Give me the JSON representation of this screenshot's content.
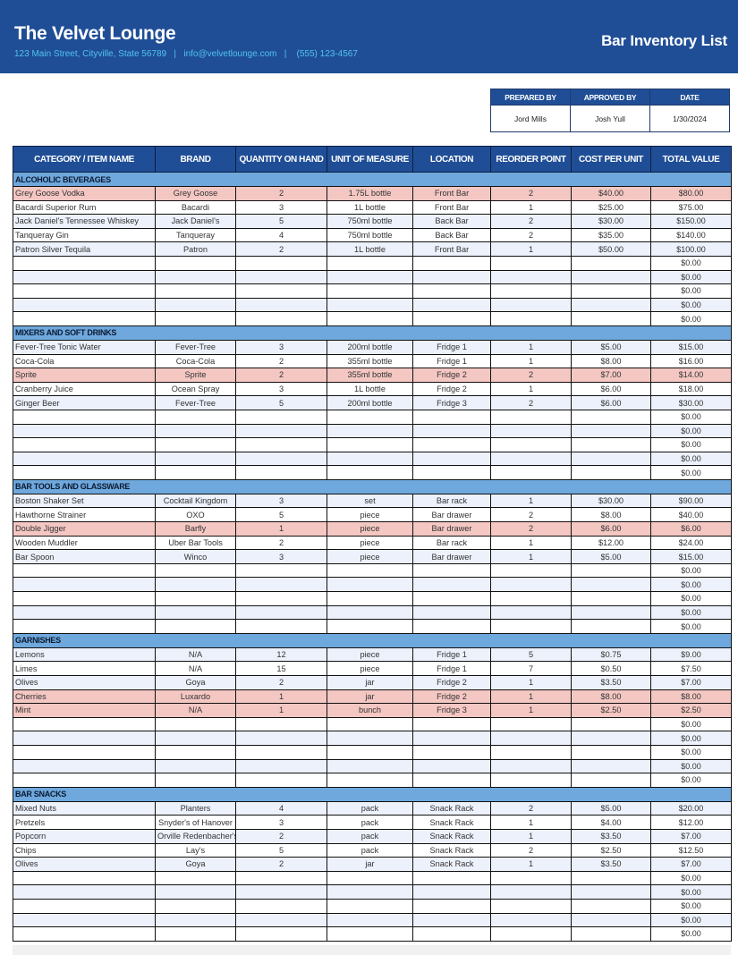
{
  "header": {
    "company_name": "The Velvet Lounge",
    "contact_line": "123 Main Street, Cityville, State 56789   |   info@velvetlounge.com   |    (555) 123-4567",
    "document_title": "Bar Inventory List"
  },
  "signoff": {
    "headers": [
      "PREPARED BY",
      "APPROVED BY",
      "DATE"
    ],
    "values": [
      "Jord Mills",
      "Josh Yull",
      "1/30/2024"
    ]
  },
  "table": {
    "columns": [
      "CATEGORY / ITEM NAME",
      "BRAND",
      "QUANTITY ON HAND",
      "UNIT OF MEASURE",
      "LOCATION",
      "REORDER POINT",
      "COST PER UNIT",
      "TOTAL VALUE"
    ],
    "sections": [
      {
        "title": "ALCOHOLIC BEVERAGES",
        "rows": [
          {
            "item": "Grey Goose Vodka",
            "brand": "Grey Goose",
            "qty": "2",
            "unit": "1.75L bottle",
            "location": "Front Bar",
            "reorder": "2",
            "cost": "$40.00",
            "total": "$80.00",
            "flag": "reorder"
          },
          {
            "item": "Bacardi Superior Rum",
            "brand": "Bacardi",
            "qty": "3",
            "unit": "1L bottle",
            "location": "Front Bar",
            "reorder": "1",
            "cost": "$25.00",
            "total": "$75.00"
          },
          {
            "item": "Jack Daniel's Tennessee Whiskey",
            "brand": "Jack Daniel's",
            "qty": "5",
            "unit": "750ml bottle",
            "location": "Back Bar",
            "reorder": "2",
            "cost": "$30.00",
            "total": "$150.00"
          },
          {
            "item": "Tanqueray Gin",
            "brand": "Tanqueray",
            "qty": "4",
            "unit": "750ml bottle",
            "location": "Back Bar",
            "reorder": "2",
            "cost": "$35.00",
            "total": "$140.00"
          },
          {
            "item": "Patron Silver Tequila",
            "brand": "Patron",
            "qty": "2",
            "unit": "1L bottle",
            "location": "Front Bar",
            "reorder": "1",
            "cost": "$50.00",
            "total": "$100.00"
          },
          {
            "total": "$0.00"
          },
          {
            "total": "$0.00"
          },
          {
            "total": "$0.00"
          },
          {
            "total": "$0.00"
          },
          {
            "total": "$0.00"
          }
        ]
      },
      {
        "title": "MIXERS AND SOFT DRINKS",
        "rows": [
          {
            "item": "Fever-Tree Tonic Water",
            "brand": "Fever-Tree",
            "qty": "3",
            "unit": "200ml bottle",
            "location": "Fridge 1",
            "reorder": "1",
            "cost": "$5.00",
            "total": "$15.00"
          },
          {
            "item": "Coca-Cola",
            "brand": "Coca-Cola",
            "qty": "2",
            "unit": "355ml bottle",
            "location": "Fridge 1",
            "reorder": "1",
            "cost": "$8.00",
            "total": "$16.00"
          },
          {
            "item": "Sprite",
            "brand": "Sprite",
            "qty": "2",
            "unit": "355ml bottle",
            "location": "Fridge 2",
            "reorder": "2",
            "cost": "$7.00",
            "total": "$14.00",
            "flag": "reorder"
          },
          {
            "item": "Cranberry Juice",
            "brand": "Ocean Spray",
            "qty": "3",
            "unit": "1L bottle",
            "location": "Fridge 2",
            "reorder": "1",
            "cost": "$6.00",
            "total": "$18.00"
          },
          {
            "item": "Ginger Beer",
            "brand": "Fever-Tree",
            "qty": "5",
            "unit": "200ml bottle",
            "location": "Fridge 3",
            "reorder": "2",
            "cost": "$6.00",
            "total": "$30.00"
          },
          {
            "total": "$0.00"
          },
          {
            "total": "$0.00"
          },
          {
            "total": "$0.00"
          },
          {
            "total": "$0.00"
          },
          {
            "total": "$0.00"
          }
        ]
      },
      {
        "title": "BAR TOOLS AND GLASSWARE",
        "rows": [
          {
            "item": "Boston Shaker Set",
            "brand": "Cocktail Kingdom",
            "qty": "3",
            "unit": "set",
            "location": "Bar rack",
            "reorder": "1",
            "cost": "$30.00",
            "total": "$90.00"
          },
          {
            "item": "Hawthorne Strainer",
            "brand": "OXO",
            "qty": "5",
            "unit": "piece",
            "location": "Bar drawer",
            "reorder": "2",
            "cost": "$8.00",
            "total": "$40.00"
          },
          {
            "item": "Double Jigger",
            "brand": "Barfly",
            "qty": "1",
            "unit": "piece",
            "location": "Bar drawer",
            "reorder": "2",
            "cost": "$6.00",
            "total": "$6.00",
            "flag": "reorder"
          },
          {
            "item": "Wooden Muddler",
            "brand": "Uber Bar Tools",
            "qty": "2",
            "unit": "piece",
            "location": "Bar rack",
            "reorder": "1",
            "cost": "$12.00",
            "total": "$24.00"
          },
          {
            "item": "Bar Spoon",
            "brand": "Winco",
            "qty": "3",
            "unit": "piece",
            "location": "Bar drawer",
            "reorder": "1",
            "cost": "$5.00",
            "total": "$15.00"
          },
          {
            "total": "$0.00"
          },
          {
            "total": "$0.00"
          },
          {
            "total": "$0.00"
          },
          {
            "total": "$0.00"
          },
          {
            "total": "$0.00"
          }
        ]
      },
      {
        "title": "GARNISHES",
        "rows": [
          {
            "item": "Lemons",
            "brand": "N/A",
            "qty": "12",
            "unit": "piece",
            "location": "Fridge 1",
            "reorder": "5",
            "cost": "$0.75",
            "total": "$9.00"
          },
          {
            "item": "Limes",
            "brand": "N/A",
            "qty": "15",
            "unit": "piece",
            "location": "Fridge 1",
            "reorder": "7",
            "cost": "$0.50",
            "total": "$7.50"
          },
          {
            "item": "Olives",
            "brand": "Goya",
            "qty": "2",
            "unit": "jar",
            "location": "Fridge 2",
            "reorder": "1",
            "cost": "$3.50",
            "total": "$7.00"
          },
          {
            "item": "Cherries",
            "brand": "Luxardo",
            "qty": "1",
            "unit": "jar",
            "location": "Fridge 2",
            "reorder": "1",
            "cost": "$8.00",
            "total": "$8.00",
            "flag": "reorder"
          },
          {
            "item": "Mint",
            "brand": "N/A",
            "qty": "1",
            "unit": "bunch",
            "location": "Fridge 3",
            "reorder": "1",
            "cost": "$2.50",
            "total": "$2.50",
            "flag": "reorder"
          },
          {
            "total": "$0.00"
          },
          {
            "total": "$0.00"
          },
          {
            "total": "$0.00"
          },
          {
            "total": "$0.00"
          },
          {
            "total": "$0.00"
          }
        ]
      },
      {
        "title": "BAR SNACKS",
        "rows": [
          {
            "item": "Mixed Nuts",
            "brand": "Planters",
            "qty": "4",
            "unit": "pack",
            "location": "Snack Rack",
            "reorder": "2",
            "cost": "$5.00",
            "total": "$20.00"
          },
          {
            "item": "Pretzels",
            "brand": "Snyder's of Hanover",
            "qty": "3",
            "unit": "pack",
            "location": "Snack Rack",
            "reorder": "1",
            "cost": "$4.00",
            "total": "$12.00"
          },
          {
            "item": "Popcorn",
            "brand": "Orville Redenbacher's",
            "qty": "2",
            "unit": "pack",
            "location": "Snack Rack",
            "reorder": "1",
            "cost": "$3.50",
            "total": "$7.00"
          },
          {
            "item": "Chips",
            "brand": "Lay's",
            "qty": "5",
            "unit": "pack",
            "location": "Snack Rack",
            "reorder": "2",
            "cost": "$2.50",
            "total": "$12.50"
          },
          {
            "item": "Olives",
            "brand": "Goya",
            "qty": "2",
            "unit": "jar",
            "location": "Snack Rack",
            "reorder": "1",
            "cost": "$3.50",
            "total": "$7.00"
          },
          {
            "total": "$0.00"
          },
          {
            "total": "$0.00"
          },
          {
            "total": "$0.00"
          },
          {
            "total": "$0.00"
          },
          {
            "total": "$0.00"
          }
        ]
      }
    ]
  },
  "colors": {
    "header_band": "#1f4e96",
    "contact_text": "#52c3f0",
    "section_header": "#6fa8dc",
    "row_stripe": "#ecf1fb",
    "reorder_highlight": "#f4c7c3"
  }
}
